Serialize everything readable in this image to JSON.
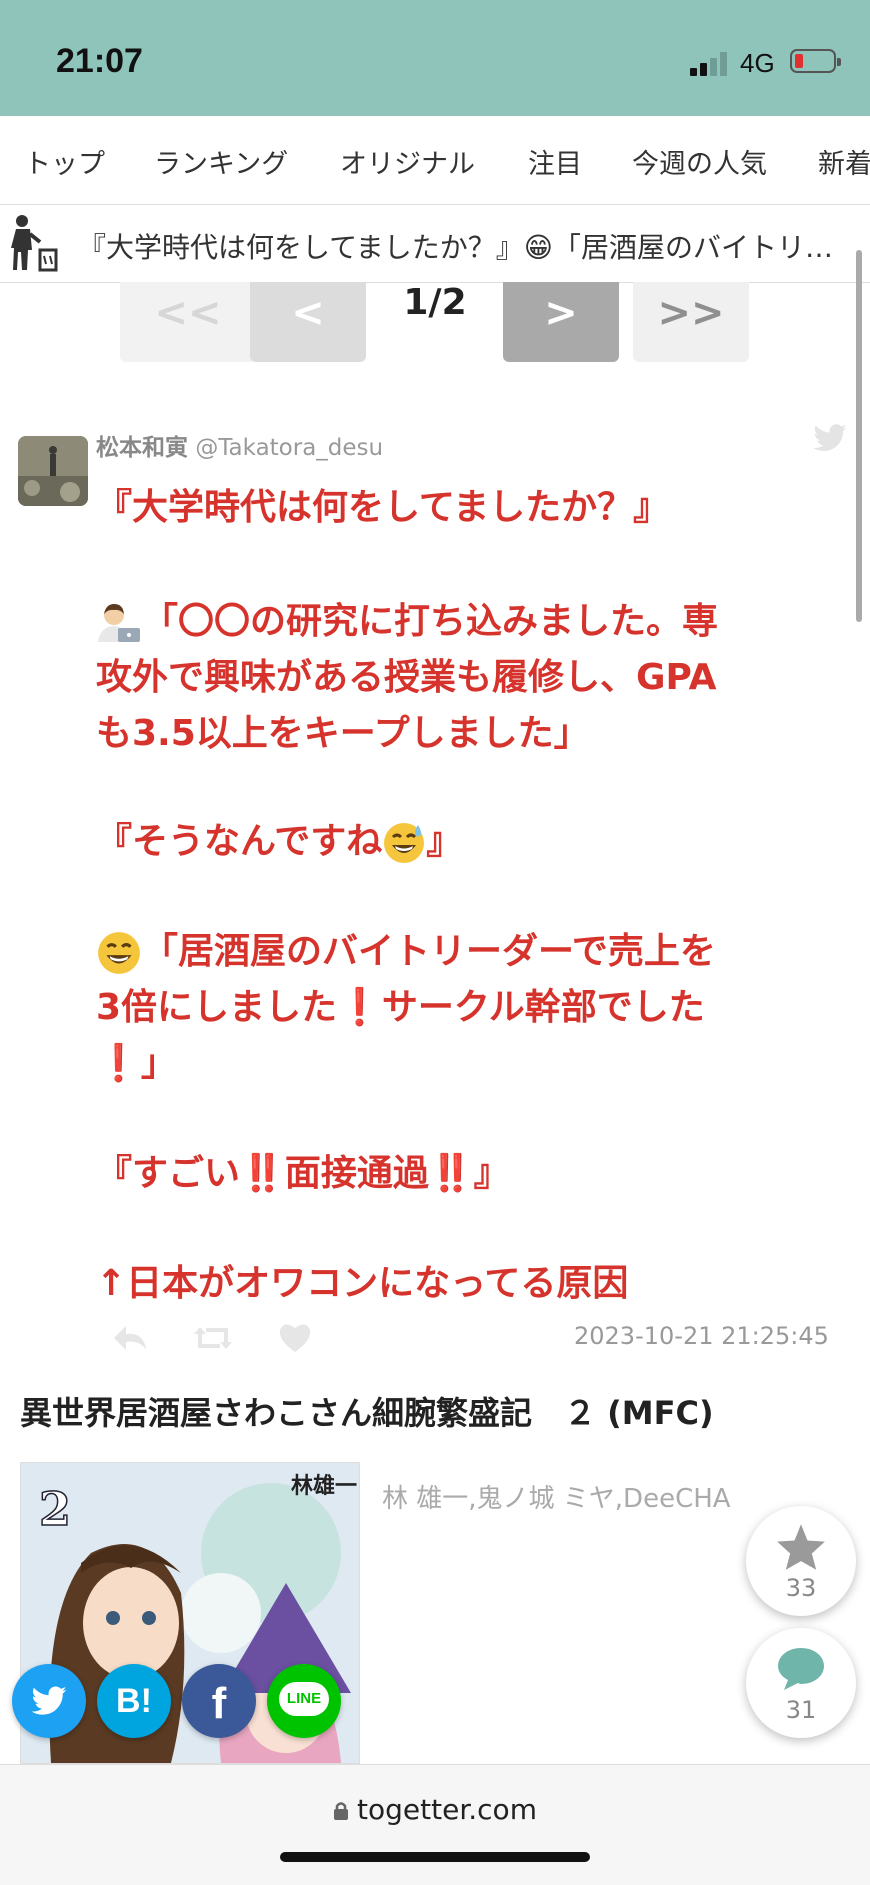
{
  "status_bar": {
    "time": "21:07",
    "network": "4G",
    "colors": {
      "background": "#8fc4bb",
      "battery_low": "#e03030"
    }
  },
  "nav": {
    "tabs": [
      "トップ",
      "ランキング",
      "オリジナル",
      "注目",
      "今週の人気",
      "新着"
    ]
  },
  "ticker": {
    "text": "『大学時代は何をしてましたか？』😁「居酒屋のバイトリ…"
  },
  "pagination": {
    "first_label": "<<",
    "prev_label": "<",
    "page_indicator": "1/2",
    "next_label": ">",
    "last_label": ">>"
  },
  "tweet": {
    "author_name": "松本和寅",
    "author_handle": "@Takatora_desu",
    "lines": [
      "『大学時代は何をしてましたか？』",
      "「〇〇の研究に打ち込みました。専",
      "攻外で興味がある授業も履修し、GPA",
      "も3.5以上をキープしました」",
      "『そうなんですね",
      "』",
      "「居酒屋のバイトリーダーで売上を",
      "3倍にしました❗サークル幹部でした",
      "❗」",
      "『すごい‼️面接通過‼️』",
      "↑日本がオワコンになってる原因"
    ],
    "timestamp": "2023-10-21 21:25:45",
    "text_color": "#d5332c"
  },
  "book": {
    "title": "異世界居酒屋さわこさん細腕繁盛記　２ (MFC)",
    "authors": "林 雄一,鬼ノ城 ミヤ,DeeCHA",
    "cover_number": "2",
    "cover_author": "林雄一"
  },
  "fabs": {
    "favorite_count": "33",
    "comment_count": "31"
  },
  "share": {
    "hatena_label": "B!",
    "facebook_label": "f",
    "line_label": "LINE"
  },
  "browser": {
    "url": "togetter.com"
  }
}
